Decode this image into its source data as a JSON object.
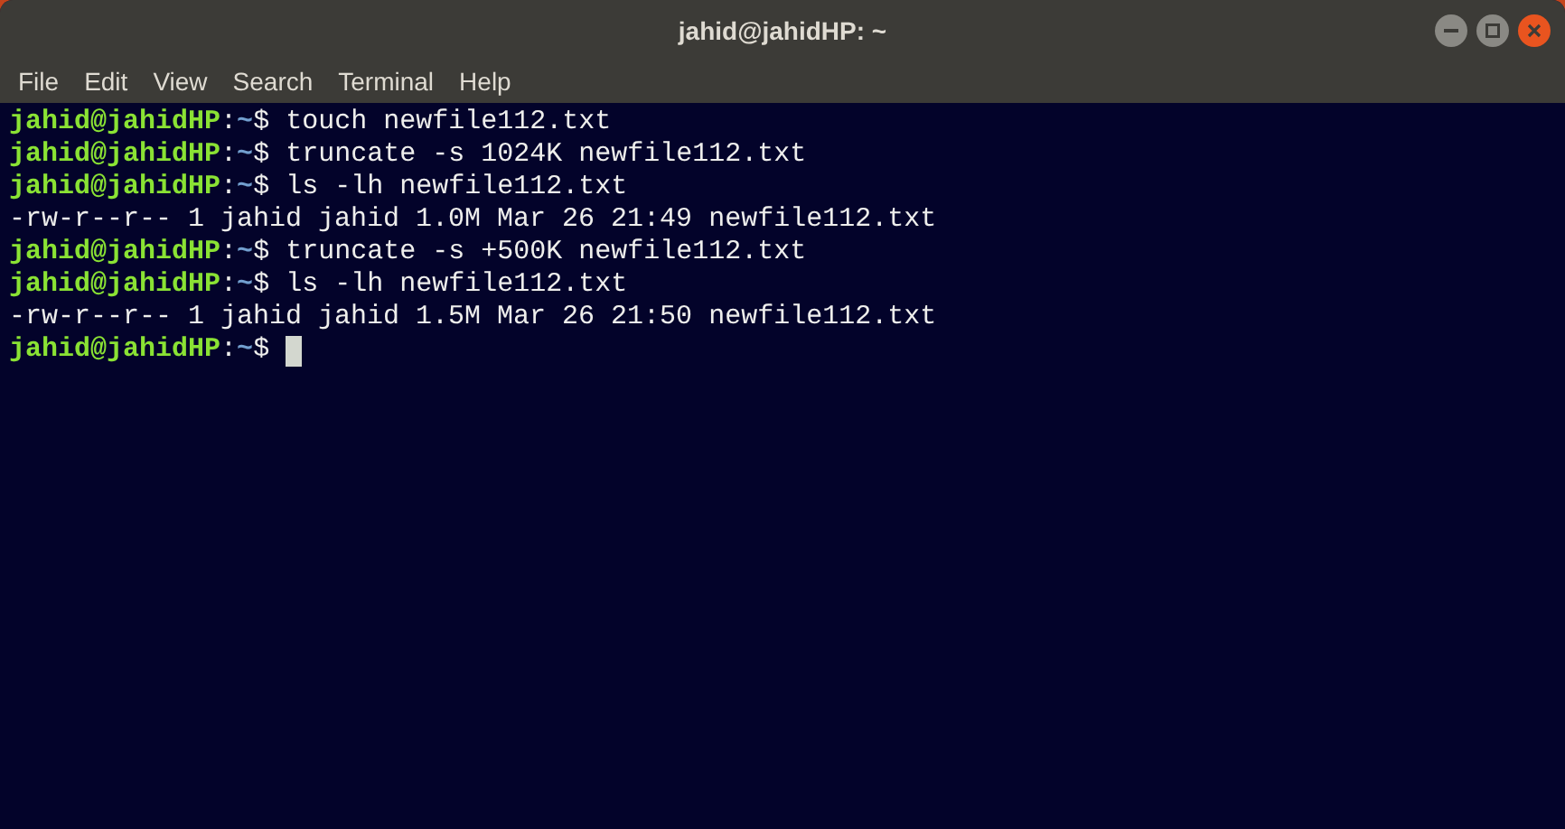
{
  "window": {
    "title": "jahid@jahidHP: ~"
  },
  "menu": [
    "File",
    "Edit",
    "View",
    "Search",
    "Terminal",
    "Help"
  ],
  "terminal": {
    "lines": [
      {
        "kind": "prompt",
        "user": "jahid@jahidHP",
        "sep": ":",
        "path": "~",
        "symbol": "$",
        "command": "touch newfile112.txt",
        "cursor": false
      },
      {
        "kind": "prompt",
        "user": "jahid@jahidHP",
        "sep": ":",
        "path": "~",
        "symbol": "$",
        "command": "truncate -s 1024K newfile112.txt",
        "cursor": false
      },
      {
        "kind": "prompt",
        "user": "jahid@jahidHP",
        "sep": ":",
        "path": "~",
        "symbol": "$",
        "command": "ls -lh newfile112.txt",
        "cursor": false
      },
      {
        "kind": "output",
        "text": "-rw-r--r-- 1 jahid jahid 1.0M Mar 26 21:49 newfile112.txt"
      },
      {
        "kind": "prompt",
        "user": "jahid@jahidHP",
        "sep": ":",
        "path": "~",
        "symbol": "$",
        "command": "truncate -s +500K newfile112.txt",
        "cursor": false
      },
      {
        "kind": "prompt",
        "user": "jahid@jahidHP",
        "sep": ":",
        "path": "~",
        "symbol": "$",
        "command": "ls -lh newfile112.txt",
        "cursor": false
      },
      {
        "kind": "output",
        "text": "-rw-r--r-- 1 jahid jahid 1.5M Mar 26 21:50 newfile112.txt"
      },
      {
        "kind": "prompt",
        "user": "jahid@jahidHP",
        "sep": ":",
        "path": "~",
        "symbol": "$",
        "cursor": true
      }
    ]
  }
}
